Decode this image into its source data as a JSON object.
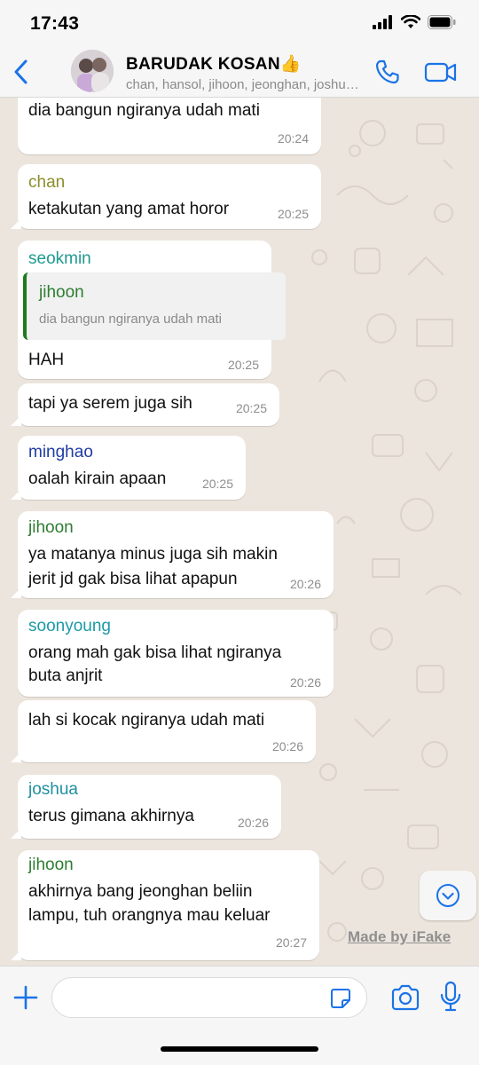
{
  "status_bar": {
    "time": "17:43"
  },
  "header": {
    "title": "BARUDAK KOSAN👍",
    "subtitle": "chan, hansol, jihoon, jeonghan, joshua, minghao, seokmin, soonyoung"
  },
  "messages": [
    {
      "sender": "",
      "text": "dia bangun ngiranya udah mati",
      "time": "20:24"
    },
    {
      "sender": "chan",
      "sender_color": "#8c8f2d",
      "text": "ketakutan yang amat horor",
      "time": "20:25"
    },
    {
      "sender": "seokmin",
      "sender_color": "#1f9a8f",
      "quote": {
        "name": "jihoon",
        "text": "dia bangun ngiranya udah mati"
      },
      "text": "HAH",
      "time": "20:25"
    },
    {
      "sender": "",
      "text": "tapi ya serem juga sih",
      "time": "20:25"
    },
    {
      "sender": "minghao",
      "sender_color": "#1f3ba3",
      "text": "oalah kirain apaan",
      "time": "20:25"
    },
    {
      "sender": "jihoon",
      "sender_color": "#2e7d32",
      "text_line1": "ya matanya minus juga sih makin",
      "text_line2": "jerit jd gak bisa lihat apapun",
      "time": "20:26"
    },
    {
      "sender": "soonyoung",
      "sender_color": "#1d9aa6",
      "text_line1": "orang mah gak bisa lihat ngiranya",
      "text_line2": "buta anjrit",
      "time": "20:26"
    },
    {
      "sender": "",
      "text": "lah si kocak ngiranya udah mati",
      "time": "20:26"
    },
    {
      "sender": "joshua",
      "sender_color": "#1f8fa0",
      "text": "terus gimana akhirnya",
      "time": "20:26"
    },
    {
      "sender": "jihoon",
      "sender_color": "#2e7d32",
      "text_line1": "akhirnya bang jeonghan beliin",
      "text_line2": "lampu, tuh orangnya mau keluar",
      "time": "20:27"
    }
  ],
  "watermark": "Made by iFake",
  "input": {
    "placeholder": ""
  },
  "colors": {
    "accent": "#1a73e8",
    "chat_bg": "#ece5dd",
    "bubble": "#ffffff"
  },
  "icons": [
    "back-icon",
    "phone-icon",
    "video-camera-icon",
    "plus-icon",
    "sticker-icon",
    "camera-icon",
    "microphone-icon",
    "chevron-down-icon"
  ]
}
